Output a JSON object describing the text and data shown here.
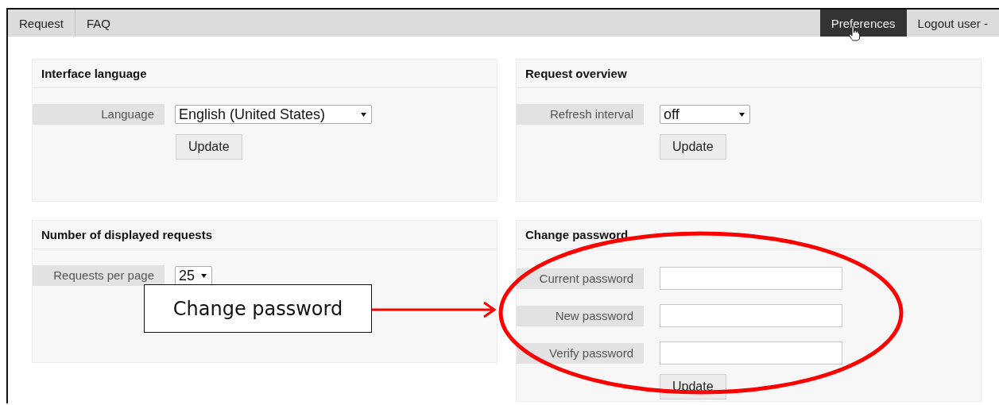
{
  "nav": {
    "left_items": [
      {
        "label": "Request",
        "selected": false
      },
      {
        "label": "FAQ",
        "selected": false
      }
    ],
    "right_items": [
      {
        "label": "Preferences",
        "selected": true
      },
      {
        "label": "Logout user -",
        "selected": false
      }
    ]
  },
  "panels": [
    {
      "title": "Interface language",
      "rows": [
        {
          "kind": "select",
          "label": "Language",
          "value": "English (United States)"
        }
      ],
      "button": "Update"
    },
    {
      "title": "Request overview",
      "rows": [
        {
          "kind": "select",
          "label": "Refresh interval",
          "value": "off"
        }
      ],
      "button": "Update"
    },
    {
      "title": "Number of displayed requests",
      "rows": [
        {
          "kind": "select",
          "label": "Requests per page",
          "value": "25"
        }
      ]
    },
    {
      "title": "Change password",
      "rows": [
        {
          "kind": "input",
          "label": "Current password"
        },
        {
          "kind": "input",
          "label": "New password"
        },
        {
          "kind": "input",
          "label": "Verify password"
        }
      ],
      "button": "Update"
    }
  ],
  "annotation": {
    "callout": "Change password"
  }
}
